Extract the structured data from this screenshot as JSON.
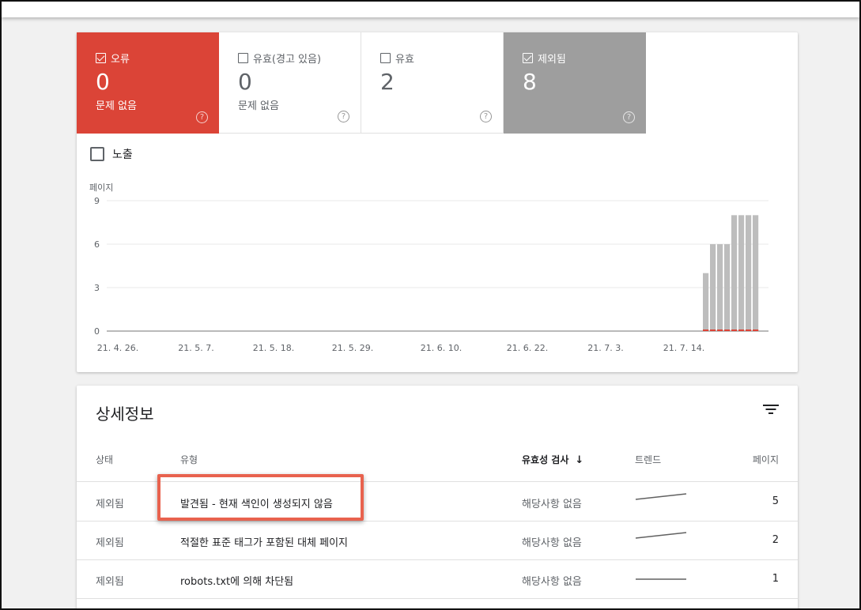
{
  "tiles": [
    {
      "label": "오류",
      "count": "0",
      "sub": "문제 없음",
      "checked": true,
      "style": "err",
      "help": "?"
    },
    {
      "label": "유효(경고 있음)",
      "count": "0",
      "sub": "문제 없음",
      "checked": false,
      "style": "plain",
      "help": "?"
    },
    {
      "label": "유효",
      "count": "2",
      "sub": "",
      "checked": false,
      "style": "plain",
      "help": "?"
    },
    {
      "label": "제외됨",
      "count": "8",
      "sub": "",
      "checked": true,
      "style": "excl",
      "help": "?"
    }
  ],
  "impressions": {
    "label": "노출",
    "checked": false
  },
  "colors": {
    "error": "#db4437",
    "excluded": "#9e9e9e",
    "accent_highlight": "#e8624e"
  },
  "chart_data": {
    "type": "bar",
    "ylabel": "페이지",
    "ylim": [
      0,
      9
    ],
    "yticks": [
      0,
      3,
      6,
      9
    ],
    "xtick_labels": [
      "21. 4. 26.",
      "21. 5. 7.",
      "21. 5. 18.",
      "21. 5. 29.",
      "21. 6. 10.",
      "21. 6. 22.",
      "21. 7. 3.",
      "21. 7. 14."
    ],
    "grid": true,
    "series": [
      {
        "values": [
          4,
          6,
          6,
          6,
          8,
          8,
          8,
          8
        ],
        "color": "#bdbdbd"
      },
      {
        "values": [
          0,
          0,
          0,
          0,
          0,
          0,
          0,
          0
        ],
        "color": "#db4437"
      }
    ]
  },
  "details": {
    "title": "상세정보",
    "filter_icon": "filter-icon",
    "columns": {
      "status": "상태",
      "type": "유형",
      "validation": "유효성 검사",
      "trend": "트렌드",
      "pages": "페이지"
    },
    "sort_icon": "↓",
    "rows": [
      {
        "status": "제외됨",
        "type": "발견됨 - 현재 색인이 생성되지 않음",
        "validation": "해당사항 없음",
        "pages": "5",
        "trend": [
          0.35,
          0.0
        ]
      },
      {
        "status": "제외됨",
        "type": "적절한 표준 태그가 포함된 대체 페이지",
        "validation": "해당사항 없음",
        "pages": "2",
        "trend": [
          0.35,
          0.0
        ]
      },
      {
        "status": "제외됨",
        "type": "robots.txt에 의해 차단됨",
        "validation": "해당사항 없음",
        "pages": "1",
        "trend": [
          0.5,
          0.5
        ]
      }
    ]
  }
}
